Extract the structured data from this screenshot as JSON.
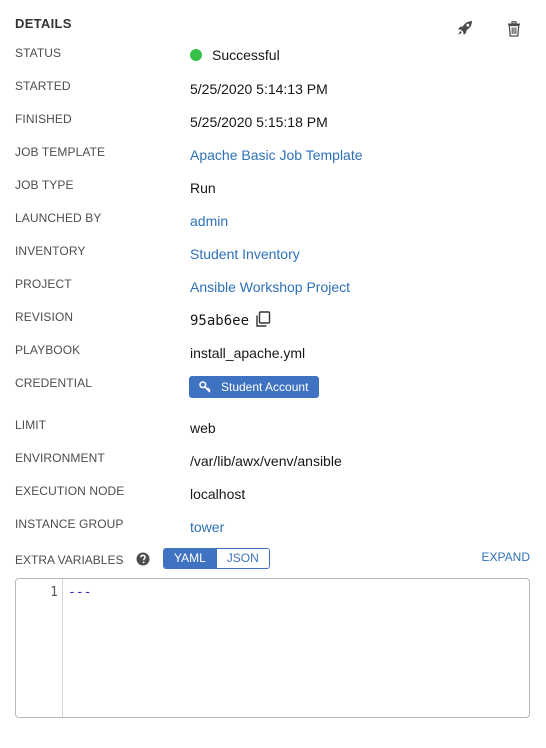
{
  "header": {
    "title": "DETAILS",
    "launch_icon": "rocket-icon",
    "delete_icon": "trash-icon"
  },
  "details": [
    {
      "key": "status",
      "label": "STATUS",
      "value": "Successful",
      "link": false
    },
    {
      "key": "started",
      "label": "STARTED",
      "value": "5/25/2020 5:14:13 PM",
      "link": false
    },
    {
      "key": "finished",
      "label": "FINISHED",
      "value": "5/25/2020 5:15:18 PM",
      "link": false
    },
    {
      "key": "job-template",
      "label": "JOB TEMPLATE",
      "value": "Apache Basic Job Template",
      "link": true
    },
    {
      "key": "job-type",
      "label": "JOB TYPE",
      "value": "Run",
      "link": false
    },
    {
      "key": "launched-by",
      "label": "LAUNCHED BY",
      "value": "admin",
      "link": true
    },
    {
      "key": "inventory",
      "label": "INVENTORY",
      "value": "Student Inventory",
      "link": true
    },
    {
      "key": "project",
      "label": "PROJECT",
      "value": "Ansible Workshop Project",
      "link": true
    },
    {
      "key": "revision",
      "label": "REVISION",
      "value": "95ab6ee",
      "link": false
    },
    {
      "key": "playbook",
      "label": "PLAYBOOK",
      "value": "install_apache.yml",
      "link": false
    },
    {
      "key": "credential",
      "label": "CREDENTIAL",
      "value": "Student Account",
      "link": true
    },
    {
      "key": "limit",
      "label": "LIMIT",
      "value": "web",
      "link": false
    },
    {
      "key": "environment",
      "label": "ENVIRONMENT",
      "value": "/var/lib/awx/venv/ansible",
      "link": false
    },
    {
      "key": "execution-node",
      "label": "EXECUTION NODE",
      "value": "localhost",
      "link": false
    },
    {
      "key": "instance-group",
      "label": "INSTANCE GROUP",
      "value": "tower",
      "link": true
    }
  ],
  "status_color": "#37c049",
  "extra_vars": {
    "label": "EXTRA VARIABLES",
    "help_icon": "question-circle-icon",
    "modes": [
      "YAML",
      "JSON"
    ],
    "active_mode": "YAML",
    "expand_label": "EXPAND",
    "lines": [
      {
        "num": "1",
        "text": "---"
      }
    ]
  },
  "colors": {
    "accent": "#3f72c0",
    "link": "#2d71b8",
    "success": "#37c049"
  }
}
